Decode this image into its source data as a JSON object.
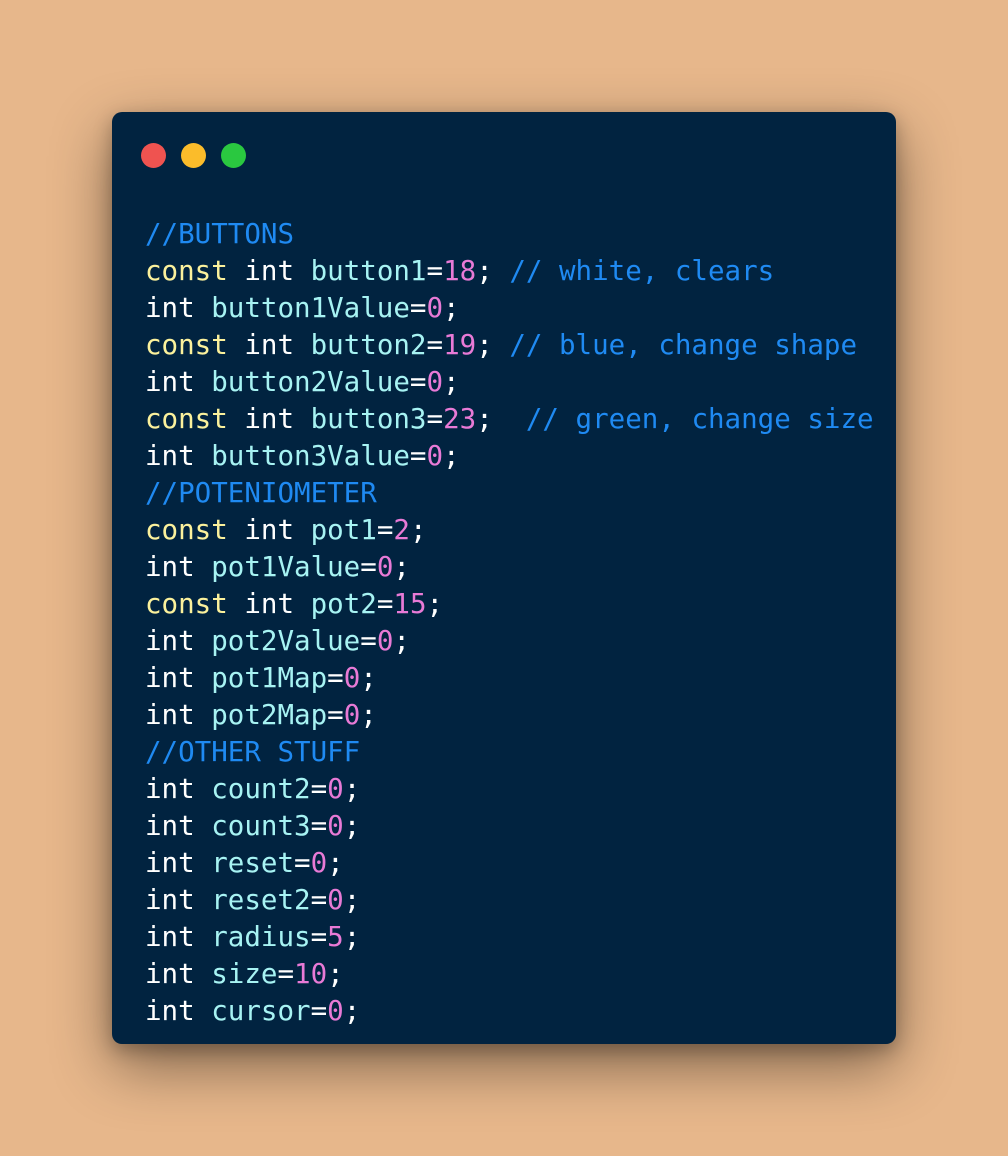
{
  "window": {
    "controls": [
      {
        "name": "close",
        "color": "#ef5350"
      },
      {
        "name": "minimize",
        "color": "#fbbc2a"
      },
      {
        "name": "maximize",
        "color": "#2ac840"
      }
    ]
  },
  "colors": {
    "background": "#e7b78b",
    "window": "#012340",
    "comment": "#1f8af2",
    "keyword": "#fbf19c",
    "type": "#ffffff",
    "identifier": "#a7f3f3",
    "number": "#e87ad6",
    "punctuation": "#ffffff"
  },
  "code": {
    "lines": [
      [
        {
          "t": "comment",
          "v": "//BUTTONS"
        }
      ],
      [
        {
          "t": "keyword",
          "v": "const"
        },
        {
          "t": "space",
          "v": " "
        },
        {
          "t": "type",
          "v": "int"
        },
        {
          "t": "space",
          "v": " "
        },
        {
          "t": "ident",
          "v": "button1"
        },
        {
          "t": "op",
          "v": "="
        },
        {
          "t": "number",
          "v": "18"
        },
        {
          "t": "punct",
          "v": ";"
        },
        {
          "t": "space",
          "v": " "
        },
        {
          "t": "comment",
          "v": "// white, clears"
        }
      ],
      [
        {
          "t": "type",
          "v": "int"
        },
        {
          "t": "space",
          "v": " "
        },
        {
          "t": "ident",
          "v": "button1Value"
        },
        {
          "t": "op",
          "v": "="
        },
        {
          "t": "number",
          "v": "0"
        },
        {
          "t": "punct",
          "v": ";"
        }
      ],
      [
        {
          "t": "keyword",
          "v": "const"
        },
        {
          "t": "space",
          "v": " "
        },
        {
          "t": "type",
          "v": "int"
        },
        {
          "t": "space",
          "v": " "
        },
        {
          "t": "ident",
          "v": "button2"
        },
        {
          "t": "op",
          "v": "="
        },
        {
          "t": "number",
          "v": "19"
        },
        {
          "t": "punct",
          "v": ";"
        },
        {
          "t": "space",
          "v": " "
        },
        {
          "t": "comment",
          "v": "// blue, change shape"
        }
      ],
      [
        {
          "t": "type",
          "v": "int"
        },
        {
          "t": "space",
          "v": " "
        },
        {
          "t": "ident",
          "v": "button2Value"
        },
        {
          "t": "op",
          "v": "="
        },
        {
          "t": "number",
          "v": "0"
        },
        {
          "t": "punct",
          "v": ";"
        }
      ],
      [
        {
          "t": "keyword",
          "v": "const"
        },
        {
          "t": "space",
          "v": " "
        },
        {
          "t": "type",
          "v": "int"
        },
        {
          "t": "space",
          "v": " "
        },
        {
          "t": "ident",
          "v": "button3"
        },
        {
          "t": "op",
          "v": "="
        },
        {
          "t": "number",
          "v": "23"
        },
        {
          "t": "punct",
          "v": ";"
        },
        {
          "t": "space",
          "v": "  "
        },
        {
          "t": "comment",
          "v": "// green, change size"
        }
      ],
      [
        {
          "t": "type",
          "v": "int"
        },
        {
          "t": "space",
          "v": " "
        },
        {
          "t": "ident",
          "v": "button3Value"
        },
        {
          "t": "op",
          "v": "="
        },
        {
          "t": "number",
          "v": "0"
        },
        {
          "t": "punct",
          "v": ";"
        }
      ],
      [
        {
          "t": "comment",
          "v": "//POTENIOMETER"
        }
      ],
      [
        {
          "t": "keyword",
          "v": "const"
        },
        {
          "t": "space",
          "v": " "
        },
        {
          "t": "type",
          "v": "int"
        },
        {
          "t": "space",
          "v": " "
        },
        {
          "t": "ident",
          "v": "pot1"
        },
        {
          "t": "op",
          "v": "="
        },
        {
          "t": "number",
          "v": "2"
        },
        {
          "t": "punct",
          "v": ";"
        }
      ],
      [
        {
          "t": "type",
          "v": "int"
        },
        {
          "t": "space",
          "v": " "
        },
        {
          "t": "ident",
          "v": "pot1Value"
        },
        {
          "t": "op",
          "v": "="
        },
        {
          "t": "number",
          "v": "0"
        },
        {
          "t": "punct",
          "v": ";"
        }
      ],
      [
        {
          "t": "keyword",
          "v": "const"
        },
        {
          "t": "space",
          "v": " "
        },
        {
          "t": "type",
          "v": "int"
        },
        {
          "t": "space",
          "v": " "
        },
        {
          "t": "ident",
          "v": "pot2"
        },
        {
          "t": "op",
          "v": "="
        },
        {
          "t": "number",
          "v": "15"
        },
        {
          "t": "punct",
          "v": ";"
        }
      ],
      [
        {
          "t": "type",
          "v": "int"
        },
        {
          "t": "space",
          "v": " "
        },
        {
          "t": "ident",
          "v": "pot2Value"
        },
        {
          "t": "op",
          "v": "="
        },
        {
          "t": "number",
          "v": "0"
        },
        {
          "t": "punct",
          "v": ";"
        }
      ],
      [
        {
          "t": "type",
          "v": "int"
        },
        {
          "t": "space",
          "v": " "
        },
        {
          "t": "ident",
          "v": "pot1Map"
        },
        {
          "t": "op",
          "v": "="
        },
        {
          "t": "number",
          "v": "0"
        },
        {
          "t": "punct",
          "v": ";"
        }
      ],
      [
        {
          "t": "type",
          "v": "int"
        },
        {
          "t": "space",
          "v": " "
        },
        {
          "t": "ident",
          "v": "pot2Map"
        },
        {
          "t": "op",
          "v": "="
        },
        {
          "t": "number",
          "v": "0"
        },
        {
          "t": "punct",
          "v": ";"
        }
      ],
      [
        {
          "t": "comment",
          "v": "//OTHER STUFF"
        }
      ],
      [
        {
          "t": "type",
          "v": "int"
        },
        {
          "t": "space",
          "v": " "
        },
        {
          "t": "ident",
          "v": "count2"
        },
        {
          "t": "op",
          "v": "="
        },
        {
          "t": "number",
          "v": "0"
        },
        {
          "t": "punct",
          "v": ";"
        }
      ],
      [
        {
          "t": "type",
          "v": "int"
        },
        {
          "t": "space",
          "v": " "
        },
        {
          "t": "ident",
          "v": "count3"
        },
        {
          "t": "op",
          "v": "="
        },
        {
          "t": "number",
          "v": "0"
        },
        {
          "t": "punct",
          "v": ";"
        }
      ],
      [
        {
          "t": "type",
          "v": "int"
        },
        {
          "t": "space",
          "v": " "
        },
        {
          "t": "ident",
          "v": "reset"
        },
        {
          "t": "op",
          "v": "="
        },
        {
          "t": "number",
          "v": "0"
        },
        {
          "t": "punct",
          "v": ";"
        }
      ],
      [
        {
          "t": "type",
          "v": "int"
        },
        {
          "t": "space",
          "v": " "
        },
        {
          "t": "ident",
          "v": "reset2"
        },
        {
          "t": "op",
          "v": "="
        },
        {
          "t": "number",
          "v": "0"
        },
        {
          "t": "punct",
          "v": ";"
        }
      ],
      [
        {
          "t": "type",
          "v": "int"
        },
        {
          "t": "space",
          "v": " "
        },
        {
          "t": "ident",
          "v": "radius"
        },
        {
          "t": "op",
          "v": "="
        },
        {
          "t": "number",
          "v": "5"
        },
        {
          "t": "punct",
          "v": ";"
        }
      ],
      [
        {
          "t": "type",
          "v": "int"
        },
        {
          "t": "space",
          "v": " "
        },
        {
          "t": "ident",
          "v": "size"
        },
        {
          "t": "op",
          "v": "="
        },
        {
          "t": "number",
          "v": "10"
        },
        {
          "t": "punct",
          "v": ";"
        }
      ],
      [
        {
          "t": "type",
          "v": "int"
        },
        {
          "t": "space",
          "v": " "
        },
        {
          "t": "ident",
          "v": "cursor"
        },
        {
          "t": "op",
          "v": "="
        },
        {
          "t": "number",
          "v": "0"
        },
        {
          "t": "punct",
          "v": ";"
        }
      ]
    ]
  }
}
